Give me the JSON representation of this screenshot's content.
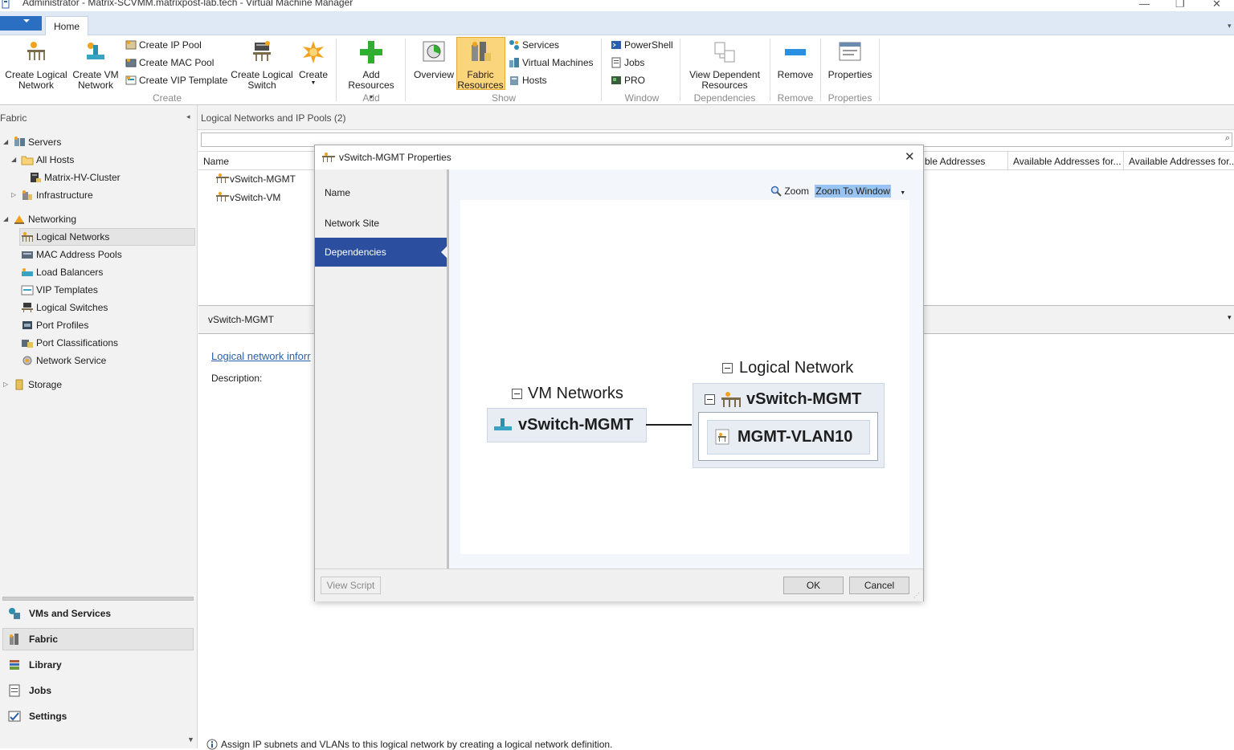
{
  "window": {
    "title": "Administrator - Matrix-SCVMM.matrixpost-lab.tech - Virtual Machine Manager"
  },
  "ribbon": {
    "tab_home": "Home",
    "create_logical_network": "Create Logical Network",
    "create_vm_network": "Create VM Network",
    "create_ip_pool": "Create IP Pool",
    "create_mac_pool": "Create MAC Pool",
    "create_vip_template": "Create VIP Template",
    "create_logical_switch": "Create Logical Switch",
    "create": "Create",
    "group_create": "Create",
    "add_resources": "Add Resources",
    "group_add": "Add",
    "overview": "Overview",
    "fabric_resources": "Fabric Resources",
    "services": "Services",
    "virtual_machines": "Virtual Machines",
    "hosts": "Hosts",
    "group_show": "Show",
    "powershell": "PowerShell",
    "jobs": "Jobs",
    "pro": "PRO",
    "group_window": "Window",
    "view_dependent_resources": "View Dependent Resources",
    "group_dependencies": "Dependencies",
    "remove": "Remove",
    "group_remove": "Remove",
    "properties": "Properties",
    "group_properties": "Properties"
  },
  "nav": {
    "header": "Fabric",
    "servers": "Servers",
    "all_hosts": "All Hosts",
    "cluster": "Matrix-HV-Cluster",
    "infrastructure": "Infrastructure",
    "networking": "Networking",
    "logical_networks": "Logical Networks",
    "mac_pools": "MAC Address Pools",
    "load_balancers": "Load Balancers",
    "vip_templates": "VIP Templates",
    "logical_switches": "Logical Switches",
    "port_profiles": "Port Profiles",
    "port_classifications": "Port Classifications",
    "network_service": "Network Service",
    "storage": "Storage",
    "ws_vms": "VMs and Services",
    "ws_fabric": "Fabric",
    "ws_library": "Library",
    "ws_jobs": "Jobs",
    "ws_settings": "Settings"
  },
  "main": {
    "header": "Logical Networks and IP Pools (2)",
    "col_name": "Name",
    "col_avail1": "ble Addresses",
    "col_avail2": "Available Addresses for...",
    "col_avail3": "Available Addresses for...",
    "rows": [
      "vSwitch-MGMT",
      "vSwitch-VM"
    ],
    "detail_title": "vSwitch-MGMT",
    "detail_link": "Logical network inforr",
    "detail_desc": "Description:",
    "info_text": "Assign IP subnets and VLANs to this logical network by creating a logical network definition."
  },
  "dialog": {
    "title": "vSwitch-MGMT Properties",
    "nav_name": "Name",
    "nav_site": "Network Site",
    "nav_dependencies": "Dependencies",
    "zoom_label": "Zoom",
    "zoom_value": "Zoom To Window",
    "view_script": "View Script",
    "ok": "OK",
    "cancel": "Cancel"
  },
  "diagram": {
    "vm_networks_header": "VM Networks",
    "vm_network_node": "vSwitch-MGMT",
    "logical_network_header": "Logical Network",
    "logical_network_node": "vSwitch-MGMT",
    "site_node": "MGMT-VLAN10"
  }
}
